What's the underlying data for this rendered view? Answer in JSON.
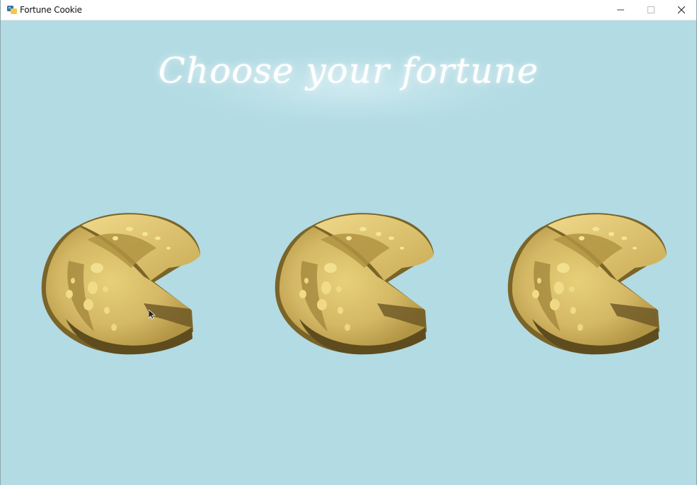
{
  "window": {
    "title": "Fortune Cookie",
    "icon": "python-app-icon",
    "controls": [
      "minimize-icon",
      "maximize-icon",
      "close-icon"
    ]
  },
  "main": {
    "heading": "Choose your fortune",
    "cookies": [
      {
        "icon": "fortune-cookie-icon"
      },
      {
        "icon": "fortune-cookie-icon"
      },
      {
        "icon": "fortune-cookie-icon"
      }
    ]
  },
  "colors": {
    "background": "#b2dbe3",
    "heading_text": "#ffffff",
    "cookie_light": "#e9d27a",
    "cookie_mid": "#c9ad5c",
    "cookie_dark": "#6e5a26"
  }
}
